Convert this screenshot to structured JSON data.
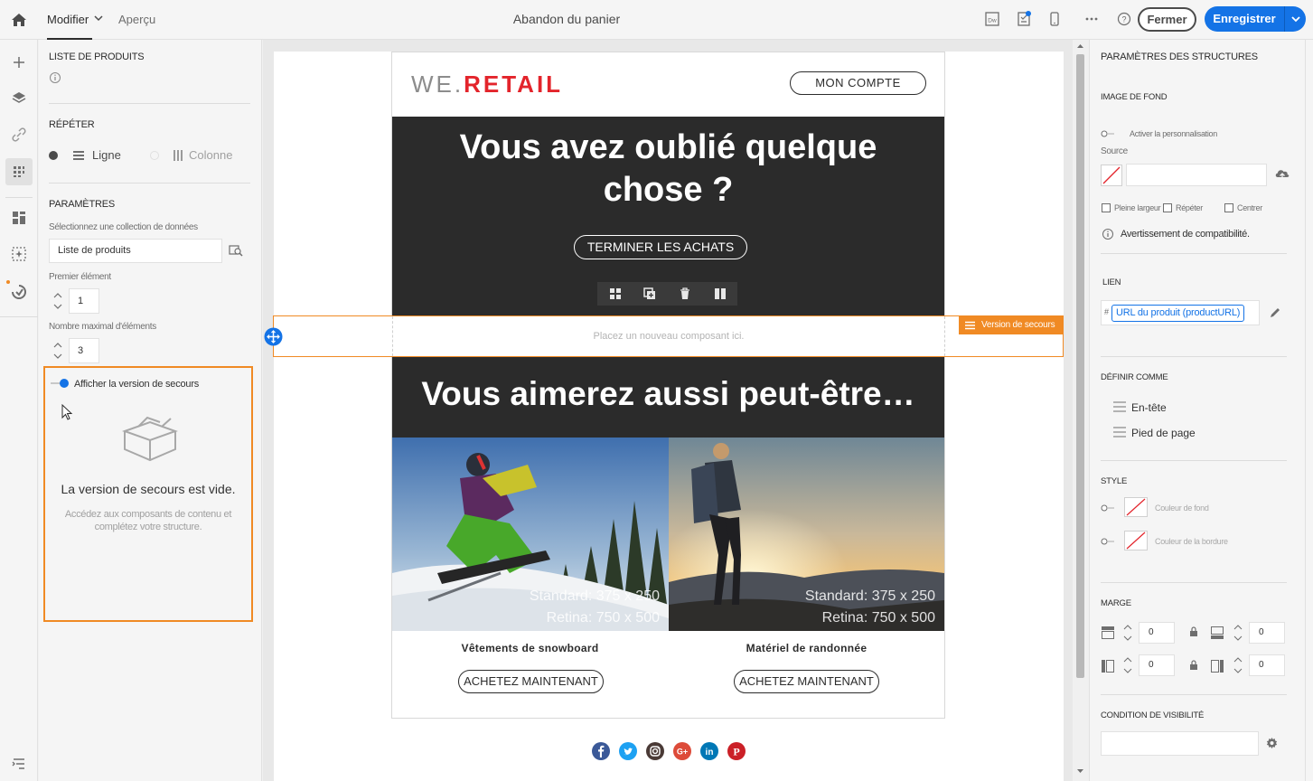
{
  "topbar": {
    "tab_modifier": "Modifier",
    "tab_apercu": "Aperçu",
    "title": "Abandon du panier",
    "btn_fermer": "Fermer",
    "btn_enregistrer": "Enregistrer",
    "dw_label": "Dw"
  },
  "left_panel": {
    "section_title": "LISTE DE PRODUITS",
    "repeter_title": "RÉPÉTER",
    "repeter_ligne": "Ligne",
    "repeter_colonne": "Colonne",
    "parametres_title": "PARAMÈTRES",
    "collection_label": "Sélectionnez une collection de données",
    "collection_value": "Liste de produits",
    "premier_label": "Premier élément",
    "premier_value": "1",
    "max_label": "Nombre maximal d'éléments",
    "max_value": "3",
    "fallback_toggle_label": "Afficher la version de secours",
    "fallback_empty_title": "La version de secours est vide.",
    "fallback_empty_desc_1": "Accédez aux composants de contenu et",
    "fallback_empty_desc_2": "complétez votre structure."
  },
  "email": {
    "logo_part1": "WE.",
    "logo_part2": "RETAIL",
    "btn_compte": "MON COMPTE",
    "hero_line1": "Vous avez oublié quelque",
    "hero_line2": "chose ?",
    "btn_terminer": "TERMINER LES ACHATS",
    "dropzone_text": "Placez un nouveau composant ici.",
    "secours_tag": "Version de secours",
    "hero2_title": "Vous aimerez aussi peut-être…",
    "products": [
      {
        "name": "Vêtements de snowboard",
        "cta": "ACHETEZ MAINTENANT",
        "cap1": "Standard: 375 x 250",
        "cap2": "Retina: 750 x 500"
      },
      {
        "name": "Matériel de randonnée",
        "cta": "ACHETEZ MAINTENANT",
        "cap1": "Standard: 375 x 250",
        "cap2": "Retina: 750 x 500"
      }
    ]
  },
  "right_panel": {
    "title": "PARAMÈTRES DES STRUCTURES",
    "image_fond_title": "IMAGE DE FOND",
    "activer_perso": "Activer la personnalisation",
    "source_label": "Source",
    "pleine_largeur": "Pleine largeur",
    "repeter": "Répéter",
    "centrer": "Centrer",
    "avertissement": "Avertissement de compatibilité.",
    "lien_title": "LIEN",
    "lien_hash": "#",
    "lien_value": "URL du produit (productURL)",
    "definir_title": "DÉFINIR COMME",
    "en_tete": "En-tête",
    "pied_page": "Pied de page",
    "style_title": "STYLE",
    "couleur_fond": "Couleur de fond",
    "couleur_bordure": "Couleur de la bordure",
    "marge_title": "MARGE",
    "marge_values": [
      "0",
      "0",
      "0",
      "0"
    ],
    "condition_title": "CONDITION DE VISIBILITÉ"
  },
  "colors": {
    "accent_blue": "#1473e6",
    "fallback_orange": "#f08a24",
    "retail_red": "#e3242b",
    "hero_bg": "#2b2b2b"
  }
}
